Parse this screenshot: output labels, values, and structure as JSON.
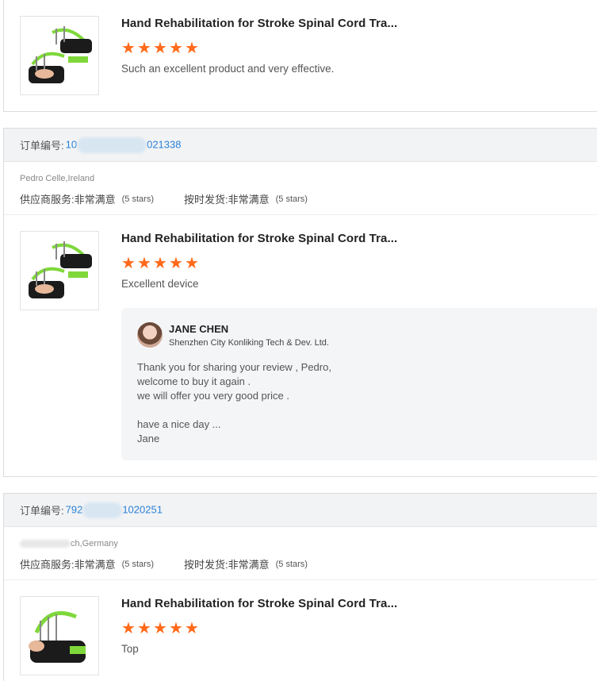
{
  "order_label": "订单编号:",
  "supplier_service_label": "供应商服务:",
  "ontime_shipping_label": "按时发货:",
  "satisfaction_text": "非常满意",
  "stars_note": "(5 stars)",
  "product_title": "Hand Rehabilitation for Stroke Spinal Cord Tra...",
  "reviews": [
    {
      "review_text": "Such an excellent product and very effective.",
      "rating": 5
    },
    {
      "order_prefix": "10",
      "order_suffix": "021338",
      "buyer_location": "Pedro Celle,Ireland",
      "review_text": "Excellent device",
      "rating": 5,
      "reply": {
        "name": "JANE CHEN",
        "company": "Shenzhen City Konliking Tech & Dev. Ltd.",
        "text": "Thank you for sharing your review , Pedro,\nwelcome to buy it again  .\nwe will offer you very good price .\n\nhave  a nice day ...\nJane"
      }
    },
    {
      "order_prefix": "792",
      "order_suffix": "1020251",
      "buyer_location": "ch,Germany",
      "review_text": "Top",
      "rating": 5
    }
  ],
  "colors": {
    "star": "#ff6a1a",
    "link": "#2a82d6",
    "bar_bg": "#f2f3f5",
    "reply_bg": "#f4f5f7"
  }
}
